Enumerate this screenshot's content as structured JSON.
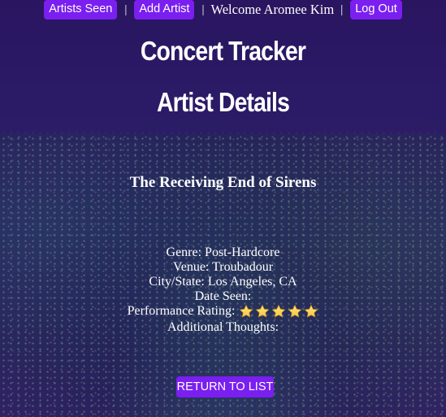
{
  "nav": {
    "artists_seen": "Artists Seen",
    "add_artist": "Add Artist",
    "welcome": "Welcome Aromee Kim",
    "log_out": "Log Out",
    "separator": "|"
  },
  "header": {
    "app_title": "Concert Tracker",
    "page_title": "Artist Details"
  },
  "artist": {
    "name": "The Receiving End of Sirens",
    "genre": "Genre: Post-Hardcore",
    "venue": "Venue: Troubadour",
    "city_state": "City/State: Los Angeles, CA",
    "date_seen": "Date Seen:",
    "rating_label": "Performance Rating:",
    "rating_stars": 5,
    "additional_thoughts": "Additional Thoughts:"
  },
  "actions": {
    "return_label": "RETURN TO LIST"
  },
  "colors": {
    "button": "#7a1ff0",
    "star": "#f6c94a"
  }
}
